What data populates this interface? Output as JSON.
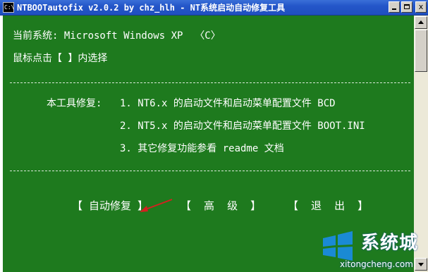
{
  "window": {
    "icon_text": "C:\\",
    "title": "NTBOOTautofix v2.0.2 by chz_hlh - NT系统启动自动修复工具",
    "close_glyph": "x"
  },
  "console": {
    "system_line": "当前系统: Microsoft Windows XP  〈C〉",
    "instruction_line": "鼠标点击【 】内选择",
    "features_label": "本工具修复:",
    "features": [
      "1. NT6.x 的启动文件和启动菜单配置文件 BCD",
      "2. NT5.x 的启动文件和启动菜单配置文件 BOOT.INI",
      "3. 其它修复功能参看 readme 文档"
    ],
    "buttons": {
      "auto_repair": "【 自动修复 】",
      "advanced": "【  高  级  】",
      "exit": "【  退  出  】"
    }
  },
  "watermark": {
    "brand": "系统城",
    "url": "xitongcheng.com"
  },
  "colors": {
    "console_background": "#1e7a1e",
    "text": "#ffffff",
    "title_bar": "#2456c9",
    "annotation_arrow": "#d42020"
  }
}
